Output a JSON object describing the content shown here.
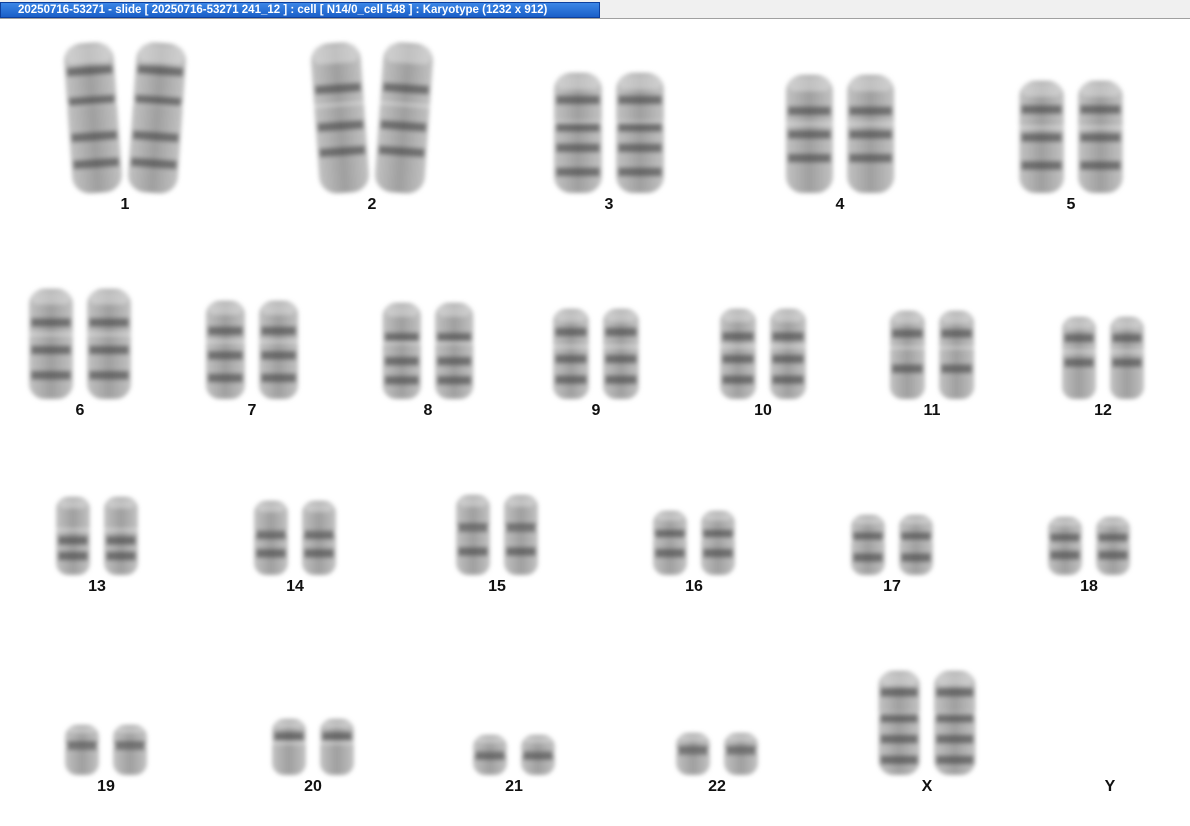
{
  "window": {
    "title": "20250716-53271 - slide [ 20250716-53271 241_12 ] : cell [ N14/0_cell 548 ] : Karyotype  (1232 x 912)"
  },
  "karyotype": {
    "chromosomes": [
      {
        "label": "1",
        "length": 1.0,
        "bands": [
          0.18,
          0.38,
          0.62,
          0.8
        ]
      },
      {
        "label": "2",
        "length": 0.98,
        "bands": [
          0.3,
          0.55,
          0.72
        ]
      },
      {
        "label": "3",
        "length": 0.78,
        "bands": [
          0.22,
          0.45,
          0.62,
          0.82
        ]
      },
      {
        "label": "4",
        "length": 0.74,
        "bands": [
          0.3,
          0.5,
          0.7
        ]
      },
      {
        "label": "5",
        "length": 0.72,
        "bands": [
          0.25,
          0.5,
          0.75
        ]
      },
      {
        "label": "6",
        "length": 0.72,
        "bands": [
          0.3,
          0.55,
          0.78
        ]
      },
      {
        "label": "7",
        "length": 0.62,
        "bands": [
          0.3,
          0.55,
          0.78
        ]
      },
      {
        "label": "8",
        "length": 0.6,
        "bands": [
          0.35,
          0.6,
          0.8
        ]
      },
      {
        "label": "9",
        "length": 0.55,
        "bands": [
          0.25,
          0.55,
          0.78
        ]
      },
      {
        "label": "10",
        "length": 0.56,
        "bands": [
          0.3,
          0.55,
          0.78
        ]
      },
      {
        "label": "11",
        "length": 0.55,
        "bands": [
          0.25,
          0.65
        ]
      },
      {
        "label": "12",
        "length": 0.52,
        "bands": [
          0.25,
          0.55
        ]
      },
      {
        "label": "13",
        "length": 0.48,
        "bands": [
          0.55,
          0.75
        ]
      },
      {
        "label": "14",
        "length": 0.46,
        "bands": [
          0.45,
          0.7
        ]
      },
      {
        "label": "15",
        "length": 0.44,
        "bands": [
          0.4,
          0.7
        ]
      },
      {
        "label": "16",
        "length": 0.38,
        "bands": [
          0.35,
          0.65
        ]
      },
      {
        "label": "17",
        "length": 0.38,
        "bands": [
          0.35,
          0.7
        ]
      },
      {
        "label": "18",
        "length": 0.36,
        "bands": [
          0.35,
          0.65
        ]
      },
      {
        "label": "19",
        "length": 0.3,
        "bands": [
          0.4
        ]
      },
      {
        "label": "20",
        "length": 0.32,
        "bands": [
          0.3
        ]
      },
      {
        "label": "21",
        "length": 0.24,
        "bands": [
          0.5
        ]
      },
      {
        "label": "22",
        "length": 0.26,
        "bands": [
          0.4
        ]
      },
      {
        "label": "X",
        "length": 0.64,
        "bands": [
          0.2,
          0.45,
          0.65,
          0.85
        ]
      },
      {
        "label": "Y",
        "length": 0,
        "bands": []
      }
    ]
  }
}
